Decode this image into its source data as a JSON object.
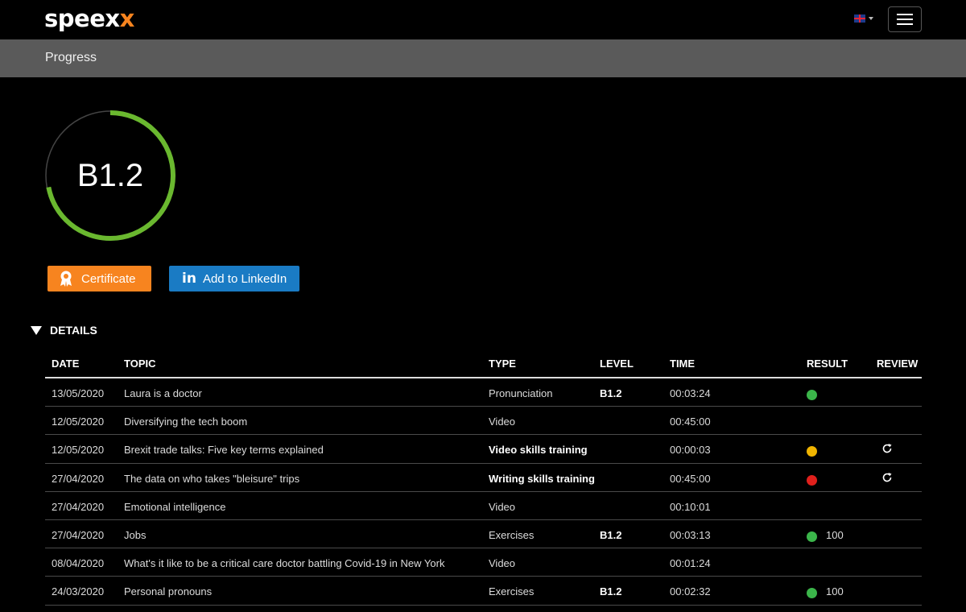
{
  "header": {
    "logo_main": "speex",
    "logo_accent": "x",
    "language_icon": "uk-flag-icon",
    "menu_icon": "hamburger-icon"
  },
  "subheader": {
    "title": "Progress"
  },
  "progress": {
    "level": "B1.2",
    "fraction": 0.72,
    "color": "#6ab82f",
    "track_color": "#444444"
  },
  "actions": {
    "certificate_label": "Certificate",
    "certificate_icon": "award-ribbon-icon",
    "linkedin_label": "Add to LinkedIn",
    "linkedin_icon": "linkedin-icon"
  },
  "details": {
    "label": "DETAILS"
  },
  "table": {
    "columns": [
      "DATE",
      "TOPIC",
      "TYPE",
      "LEVEL",
      "TIME",
      "RESULT",
      "REVIEW"
    ],
    "rows": [
      {
        "date": "13/05/2020",
        "topic": "Laura is a doctor",
        "type": "Pronunciation",
        "type_bold": false,
        "level": "B1.2",
        "time": "00:03:24",
        "result_color": "#3bb54a",
        "result_value": "",
        "review": false
      },
      {
        "date": "12/05/2020",
        "topic": "Diversifying the tech boom",
        "type": "Video",
        "type_bold": false,
        "level": "",
        "time": "00:45:00",
        "result_color": "",
        "result_value": "",
        "review": false
      },
      {
        "date": "12/05/2020",
        "topic": "Brexit trade talks: Five key terms explained",
        "type": "Video skills training",
        "type_bold": true,
        "level": "",
        "time": "00:00:03",
        "result_color": "#f0b400",
        "result_value": "",
        "review": true
      },
      {
        "date": "27/04/2020",
        "topic": "The data on who takes \"bleisure\" trips",
        "type": "Writing skills training",
        "type_bold": true,
        "level": "",
        "time": "00:45:00",
        "result_color": "#e0201c",
        "result_value": "",
        "review": true
      },
      {
        "date": "27/04/2020",
        "topic": "Emotional intelligence",
        "type": "Video",
        "type_bold": false,
        "level": "",
        "time": "00:10:01",
        "result_color": "",
        "result_value": "",
        "review": false
      },
      {
        "date": "27/04/2020",
        "topic": "Jobs",
        "type": "Exercises",
        "type_bold": false,
        "level": "B1.2",
        "time": "00:03:13",
        "result_color": "#3bb54a",
        "result_value": "100",
        "review": false
      },
      {
        "date": "08/04/2020",
        "topic": "What's it like to be a critical care doctor battling Covid-19 in New York",
        "type": "Video",
        "type_bold": false,
        "level": "",
        "time": "00:01:24",
        "result_color": "",
        "result_value": "",
        "review": false
      },
      {
        "date": "24/03/2020",
        "topic": "Personal pronouns",
        "type": "Exercises",
        "type_bold": false,
        "level": "B1.2",
        "time": "00:02:32",
        "result_color": "#3bb54a",
        "result_value": "100",
        "review": false
      }
    ],
    "review_icon": "refresh-icon"
  }
}
